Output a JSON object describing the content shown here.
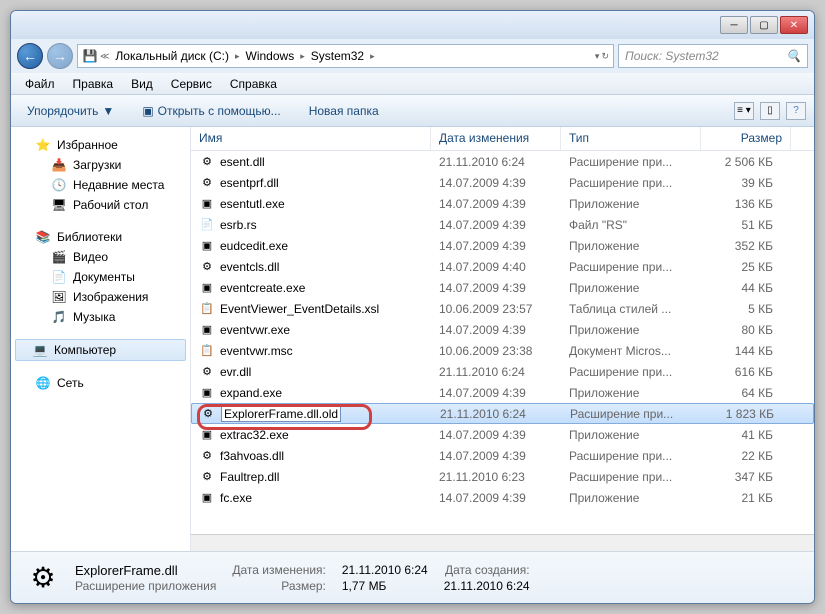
{
  "breadcrumb": [
    "Локальный диск (C:)",
    "Windows",
    "System32"
  ],
  "search_placeholder": "Поиск: System32",
  "menubar": [
    "Файл",
    "Правка",
    "Вид",
    "Сервис",
    "Справка"
  ],
  "toolbar": {
    "organize": "Упорядочить",
    "open_with": "Открыть с помощью...",
    "new_folder": "Новая папка"
  },
  "sidebar": {
    "favorites": {
      "label": "Избранное",
      "items": [
        "Загрузки",
        "Недавние места",
        "Рабочий стол"
      ]
    },
    "libraries": {
      "label": "Библиотеки",
      "items": [
        "Видео",
        "Документы",
        "Изображения",
        "Музыка"
      ]
    },
    "computer": "Компьютер",
    "network": "Сеть"
  },
  "columns": {
    "name": "Имя",
    "date": "Дата изменения",
    "type": "Тип",
    "size": "Размер"
  },
  "files": [
    {
      "icon": "⚙",
      "name": "esent.dll",
      "date": "21.11.2010 6:24",
      "type": "Расширение при...",
      "size": "2 506 КБ"
    },
    {
      "icon": "⚙",
      "name": "esentprf.dll",
      "date": "14.07.2009 4:39",
      "type": "Расширение при...",
      "size": "39 КБ"
    },
    {
      "icon": "▣",
      "name": "esentutl.exe",
      "date": "14.07.2009 4:39",
      "type": "Приложение",
      "size": "136 КБ"
    },
    {
      "icon": "📄",
      "name": "esrb.rs",
      "date": "14.07.2009 4:39",
      "type": "Файл \"RS\"",
      "size": "51 КБ"
    },
    {
      "icon": "▣",
      "name": "eudcedit.exe",
      "date": "14.07.2009 4:39",
      "type": "Приложение",
      "size": "352 КБ"
    },
    {
      "icon": "⚙",
      "name": "eventcls.dll",
      "date": "14.07.2009 4:40",
      "type": "Расширение при...",
      "size": "25 КБ"
    },
    {
      "icon": "▣",
      "name": "eventcreate.exe",
      "date": "14.07.2009 4:39",
      "type": "Приложение",
      "size": "44 КБ"
    },
    {
      "icon": "📋",
      "name": "EventViewer_EventDetails.xsl",
      "date": "10.06.2009 23:57",
      "type": "Таблица стилей ...",
      "size": "5 КБ"
    },
    {
      "icon": "▣",
      "name": "eventvwr.exe",
      "date": "14.07.2009 4:39",
      "type": "Приложение",
      "size": "80 КБ"
    },
    {
      "icon": "📋",
      "name": "eventvwr.msc",
      "date": "10.06.2009 23:38",
      "type": "Документ Micros...",
      "size": "144 КБ"
    },
    {
      "icon": "⚙",
      "name": "evr.dll",
      "date": "21.11.2010 6:24",
      "type": "Расширение при...",
      "size": "616 КБ"
    },
    {
      "icon": "▣",
      "name": "expand.exe",
      "date": "14.07.2009 4:39",
      "type": "Приложение",
      "size": "64 КБ"
    },
    {
      "icon": "⚙",
      "name": "ExplorerFrame.dll.old",
      "date": "21.11.2010 6:24",
      "type": "Расширение при...",
      "size": "1 823 КБ",
      "selected": true,
      "rename": true
    },
    {
      "icon": "▣",
      "name": "extrac32.exe",
      "date": "14.07.2009 4:39",
      "type": "Приложение",
      "size": "41 КБ"
    },
    {
      "icon": "⚙",
      "name": "f3ahvoas.dll",
      "date": "14.07.2009 4:39",
      "type": "Расширение при...",
      "size": "22 КБ"
    },
    {
      "icon": "⚙",
      "name": "Faultrep.dll",
      "date": "21.11.2010 6:23",
      "type": "Расширение при...",
      "size": "347 КБ"
    },
    {
      "icon": "▣",
      "name": "fc.exe",
      "date": "14.07.2009 4:39",
      "type": "Приложение",
      "size": "21 КБ"
    }
  ],
  "details": {
    "filename": "ExplorerFrame.dll",
    "filetype": "Расширение приложения",
    "date_label": "Дата изменения:",
    "date": "21.11.2010 6:24",
    "size_label": "Размер:",
    "size": "1,77 МБ",
    "created_label": "Дата создания:",
    "created": "21.11.2010 6:24"
  }
}
